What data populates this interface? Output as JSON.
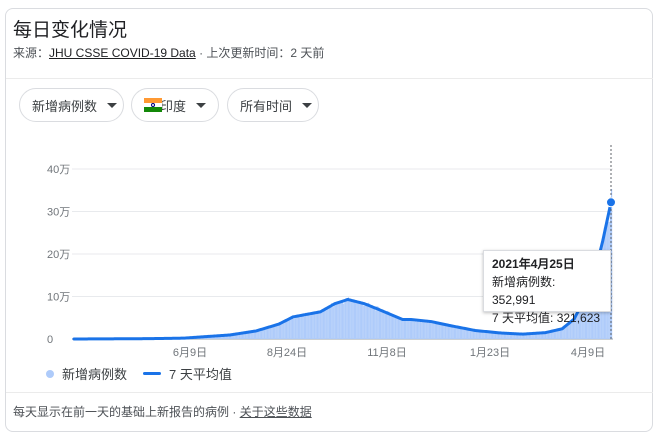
{
  "header": {
    "title": "每日变化情况",
    "source_prefix": "来源：",
    "source_link": "JHU CSSE COVID-19 Data",
    "separator": " · ",
    "updated": "上次更新时间：2 天前"
  },
  "filters": [
    {
      "label": "新增病例数"
    },
    {
      "label": "印度",
      "icon": "india-flag-icon"
    },
    {
      "label": "所有时间"
    }
  ],
  "tooltip": {
    "date": "2021年4月25日",
    "new_cases_label": "新增病例数:",
    "new_cases_value": "352,991",
    "avg_label": "7 天平均值:",
    "avg_value": "321,623"
  },
  "legend": {
    "bars_label": "新增病例数",
    "line_label": "7 天平均值"
  },
  "footer": {
    "note": "每天显示在前一天的基础上新报告的病例",
    "separator": " · ",
    "link": "关于这些数据"
  },
  "colors": {
    "bar": "#aecbfa",
    "line": "#1a73e8",
    "grid": "#e8eaed"
  },
  "chart_data": {
    "type": "bar",
    "overlay": "line",
    "ylim": [
      0,
      400000
    ],
    "yticks": [
      {
        "value": 0,
        "label": "0"
      },
      {
        "value": 100000,
        "label": "10万"
      },
      {
        "value": 200000,
        "label": "20万"
      },
      {
        "value": 300000,
        "label": "30万"
      },
      {
        "value": 400000,
        "label": "40万"
      }
    ],
    "xticks": [
      "6月9日",
      "8月24日",
      "11月8日",
      "1月23日",
      "4月9日"
    ],
    "x_range": [
      "2020-01-30",
      "2021-04-25"
    ],
    "series": [
      {
        "name": "新增病例数",
        "style": "bars"
      },
      {
        "name": "7 天平均值",
        "style": "line"
      }
    ],
    "seven_day_average_points": [
      [
        "2020-01-30",
        0
      ],
      [
        "2020-04-01",
        800
      ],
      [
        "2020-05-01",
        2000
      ],
      [
        "2020-06-09",
        9500
      ],
      [
        "2020-07-01",
        19000
      ],
      [
        "2020-07-20",
        35000
      ],
      [
        "2020-08-01",
        52000
      ],
      [
        "2020-08-24",
        64000
      ],
      [
        "2020-09-05",
        83000
      ],
      [
        "2020-09-16",
        93000
      ],
      [
        "2020-09-30",
        83000
      ],
      [
        "2020-10-15",
        66000
      ],
      [
        "2020-11-01",
        46000
      ],
      [
        "2020-11-08",
        46000
      ],
      [
        "2020-11-25",
        41000
      ],
      [
        "2020-12-10",
        32000
      ],
      [
        "2021-01-01",
        20000
      ],
      [
        "2021-01-23",
        14000
      ],
      [
        "2021-02-10",
        11500
      ],
      [
        "2021-03-01",
        15000
      ],
      [
        "2021-03-15",
        24000
      ],
      [
        "2021-03-25",
        47000
      ],
      [
        "2021-04-09",
        128000
      ],
      [
        "2021-04-18",
        230000
      ],
      [
        "2021-04-25",
        321623
      ]
    ],
    "highlight": {
      "date": "2021-04-25",
      "new_cases": 352991,
      "average": 321623
    }
  }
}
